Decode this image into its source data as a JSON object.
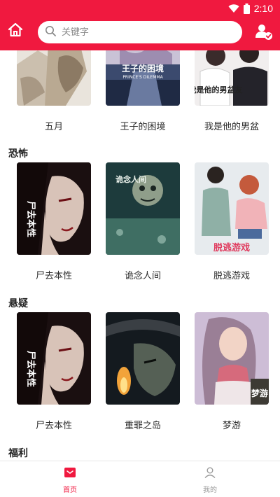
{
  "status": {
    "time": "2:10"
  },
  "header": {
    "search_placeholder": "关键字",
    "home_icon": "home-icon",
    "user_icon": "user-check-icon",
    "accent": "#f0193f"
  },
  "row_top": {
    "items": [
      {
        "title": "五月",
        "cover_caption": ""
      },
      {
        "title": "王子的困境",
        "cover_caption": "王子的困境",
        "cover_subcaption": "PRINCE'S DILEMMA"
      },
      {
        "title": "我是他的男盆",
        "cover_caption": "我是他的男盆友"
      }
    ]
  },
  "sections": [
    {
      "label": "恐怖",
      "items": [
        {
          "title": "尸去本性",
          "cover_caption": "尸去本性"
        },
        {
          "title": "诡念人间",
          "cover_caption": "诡念人间"
        },
        {
          "title": "脱逃游戏",
          "cover_caption": "脱逃游戏"
        }
      ]
    },
    {
      "label": "悬疑",
      "items": [
        {
          "title": "尸去本性",
          "cover_caption": "尸去本性"
        },
        {
          "title": "重罪之岛",
          "cover_caption": ""
        },
        {
          "title": "梦游",
          "cover_caption": "梦游"
        }
      ]
    },
    {
      "label": "福利",
      "items": []
    }
  ],
  "bottom_nav": [
    {
      "label": "首页",
      "active": true
    },
    {
      "label": "我的",
      "active": false
    }
  ]
}
